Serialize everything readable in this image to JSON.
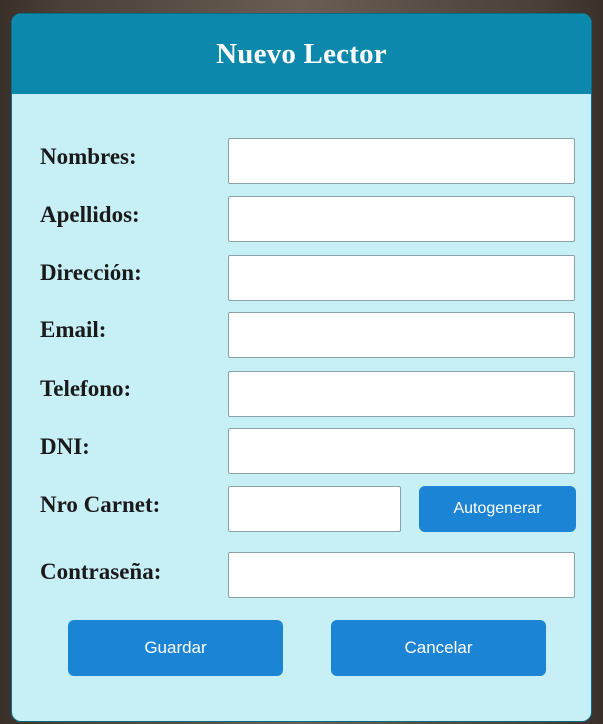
{
  "dialog": {
    "title": "Nuevo Lector"
  },
  "form": {
    "fields": [
      {
        "label": "Nombres:",
        "value": ""
      },
      {
        "label": "Apellidos:",
        "value": ""
      },
      {
        "label": "Dirección:",
        "value": ""
      },
      {
        "label": "Email:",
        "value": ""
      },
      {
        "label": "Telefono:",
        "value": ""
      },
      {
        "label": "DNI:",
        "value": ""
      },
      {
        "label": "Nro Carnet:",
        "value": ""
      },
      {
        "label": "Contraseña:",
        "value": ""
      }
    ],
    "autogenerate_label": "Autogenerar"
  },
  "actions": {
    "save_label": "Guardar",
    "cancel_label": "Cancelar"
  },
  "colors": {
    "header_bg": "#0d88ad",
    "panel_bg": "#c7eff6",
    "button_bg": "#1c84d4"
  }
}
